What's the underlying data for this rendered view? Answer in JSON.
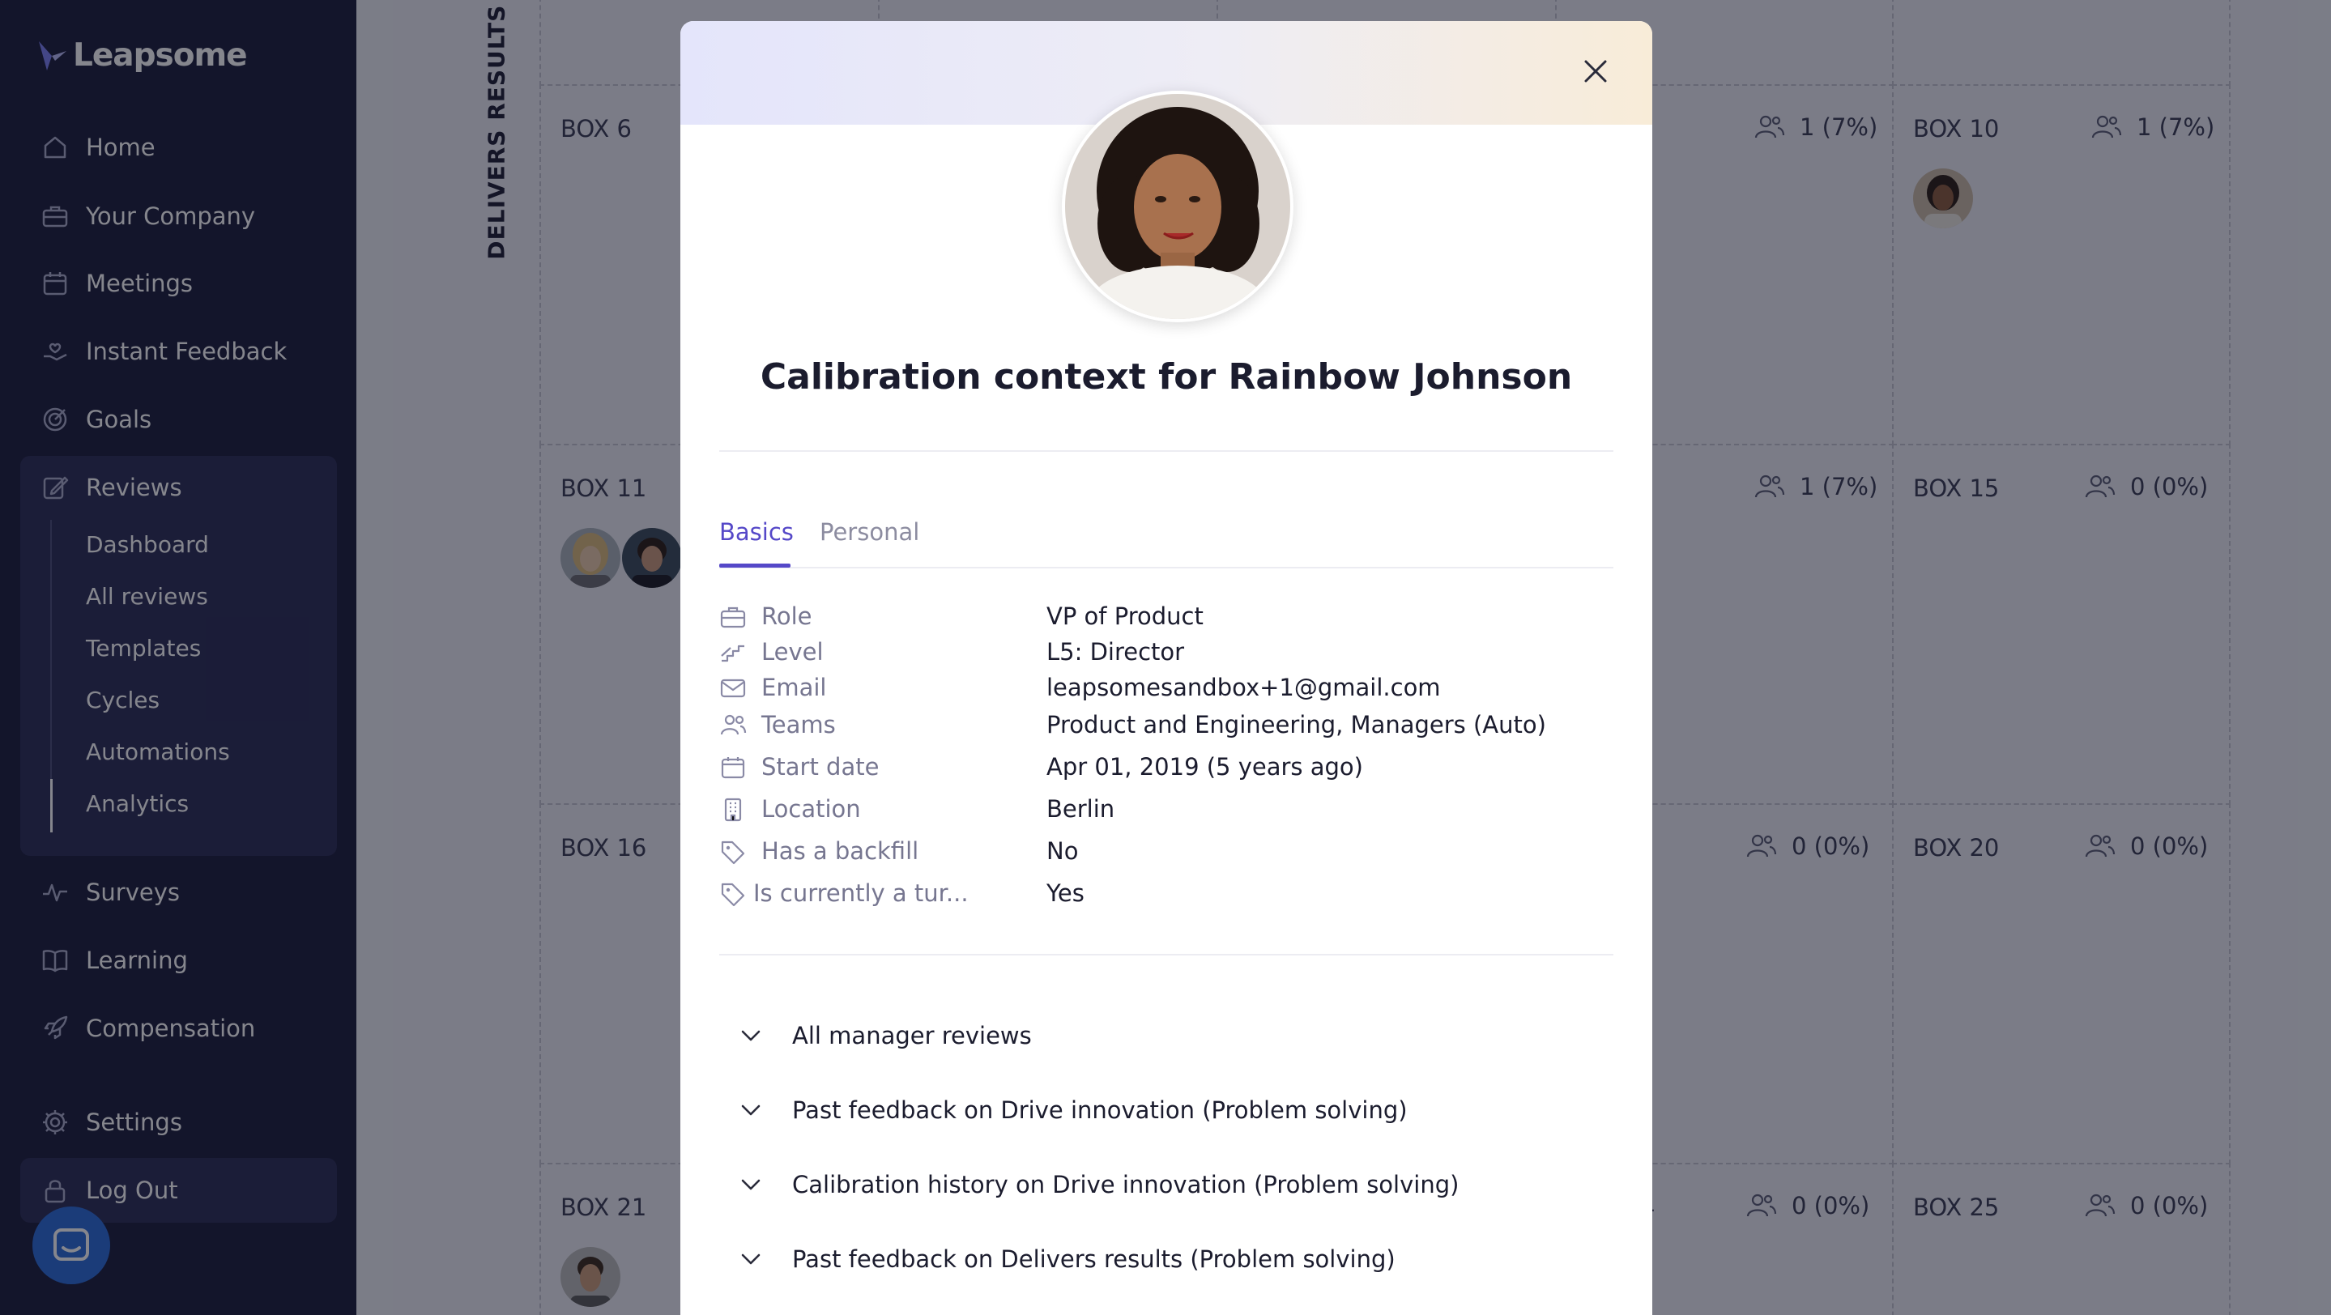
{
  "app": {
    "brand": "Leapsome",
    "accent": "#5548c8",
    "sidebar_bg": "#1b1c3a"
  },
  "sidebar": {
    "items": [
      {
        "label": "Home",
        "icon": "home-icon"
      },
      {
        "label": "Your Company",
        "icon": "briefcase-icon"
      },
      {
        "label": "Meetings",
        "icon": "calendar-icon"
      },
      {
        "label": "Instant Feedback",
        "icon": "hand-heart-icon"
      },
      {
        "label": "Goals",
        "icon": "target-icon"
      },
      {
        "label": "Reviews",
        "icon": "edit-icon"
      },
      {
        "label": "Surveys",
        "icon": "pulse-icon"
      },
      {
        "label": "Learning",
        "icon": "book-icon"
      },
      {
        "label": "Compensation",
        "icon": "rocket-icon"
      },
      {
        "label": "Settings",
        "icon": "gear-icon"
      },
      {
        "label": "Log Out",
        "icon": "lock-icon"
      }
    ],
    "reviews_sub": [
      "Dashboard",
      "All reviews",
      "Templates",
      "Cycles",
      "Automations",
      "Analytics"
    ],
    "active_sub": "Analytics"
  },
  "grid": {
    "axis_label": "DELIVERS RESULTS (PRO",
    "boxes": [
      {
        "title": "BOX 6",
        "count": ""
      },
      {
        "title": "",
        "count": "1 (7%)"
      },
      {
        "title": "BOX 10",
        "count": "1 (7%)"
      },
      {
        "title": "BOX 11",
        "count": ""
      },
      {
        "title": "",
        "count": "1 (7%)"
      },
      {
        "title": "BOX 15",
        "count": "0 (0%)"
      },
      {
        "title": "BOX 16",
        "count": ""
      },
      {
        "title": "",
        "count": "0 (0%)"
      },
      {
        "title": "BOX 20",
        "count": "0 (0%)"
      },
      {
        "title": "BOX 21",
        "count": ""
      },
      {
        "title": "",
        "count": "0 (0%)"
      },
      {
        "title": "BOX 25",
        "count": "0 (0%)"
      }
    ],
    "partial_glyph": "4"
  },
  "modal": {
    "title": "Calibration context for Rainbow Johnson",
    "tabs": [
      "Basics",
      "Personal"
    ],
    "active_tab": "Basics",
    "fields": [
      {
        "label": "Role",
        "value": "VP of Product",
        "icon": "briefcase-icon"
      },
      {
        "label": "Level",
        "value": "L5: Director",
        "icon": "stairs-icon"
      },
      {
        "label": "Email",
        "value": "leapsomesandbox+1@gmail.com",
        "icon": "mail-icon"
      },
      {
        "label": "Teams",
        "value": "Product and Engineering, Managers (Auto)",
        "icon": "people-icon"
      },
      {
        "label": "Start date",
        "value": "Apr 01, 2019 (5 years ago)",
        "icon": "calendar-icon"
      },
      {
        "label": "Location",
        "value": "Berlin",
        "icon": "building-icon"
      },
      {
        "label": "Has a backfill",
        "value": "No",
        "icon": "tag-icon"
      },
      {
        "label": "Is currently a tur...",
        "value": "Yes",
        "icon": "tag-icon"
      }
    ],
    "accordions": [
      "All manager reviews",
      "Past feedback on Drive innovation (Problem solving)",
      "Calibration history on Drive innovation (Problem solving)",
      "Past feedback on Delivers results (Problem solving)"
    ]
  }
}
